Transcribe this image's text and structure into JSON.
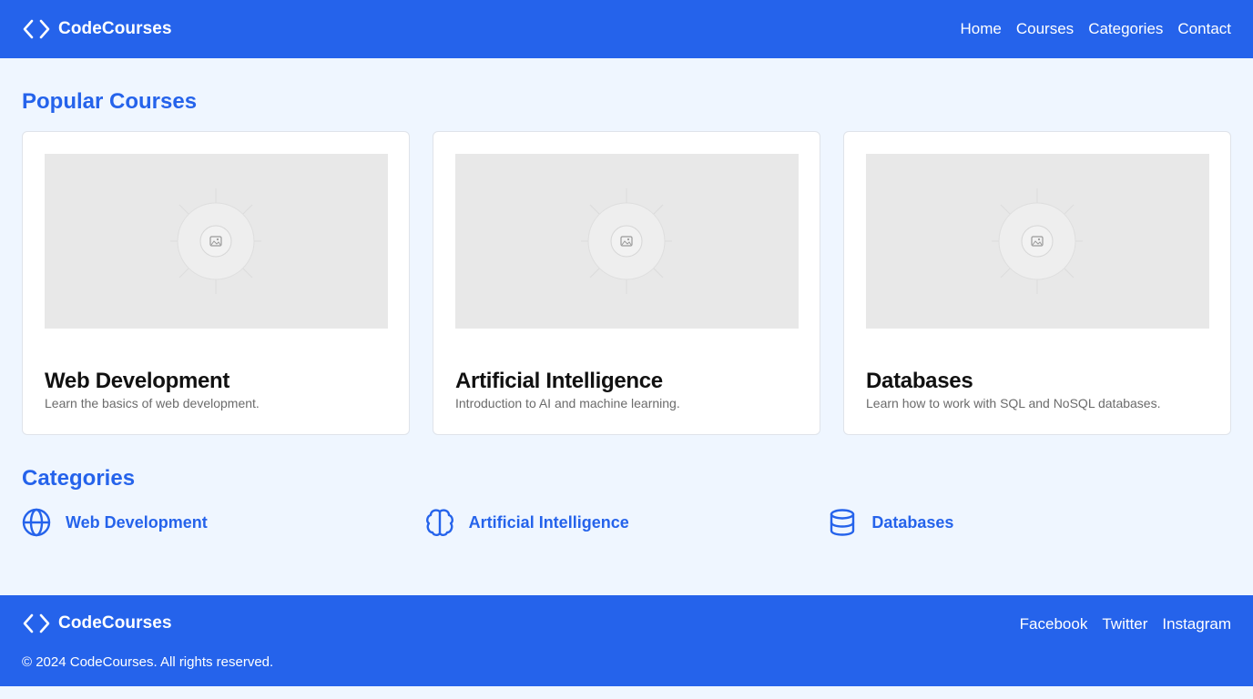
{
  "header": {
    "brand": "CodeCourses",
    "nav": [
      "Home",
      "Courses",
      "Categories",
      "Contact"
    ]
  },
  "popular": {
    "title": "Popular Courses",
    "courses": [
      {
        "title": "Web Development",
        "description": "Learn the basics of web development.",
        "image_icon": "image-placeholder-icon"
      },
      {
        "title": "Artificial Intelligence",
        "description": "Introduction to AI and machine learning.",
        "image_icon": "image-placeholder-icon"
      },
      {
        "title": "Databases",
        "description": "Learn how to work with SQL and NoSQL databases.",
        "image_icon": "image-placeholder-icon"
      }
    ]
  },
  "categories": {
    "title": "Categories",
    "items": [
      {
        "label": "Web Development",
        "icon": "globe-icon"
      },
      {
        "label": "Artificial Intelligence",
        "icon": "brain-icon"
      },
      {
        "label": "Databases",
        "icon": "database-icon"
      }
    ]
  },
  "footer": {
    "brand": "CodeCourses",
    "links": [
      "Facebook",
      "Twitter",
      "Instagram"
    ],
    "copyright": "© 2024 CodeCourses. All rights reserved."
  },
  "colors": {
    "primary": "#2563eb",
    "page_background": "#eff6ff",
    "card_background": "#ffffff",
    "placeholder": "#e8e8e8"
  }
}
